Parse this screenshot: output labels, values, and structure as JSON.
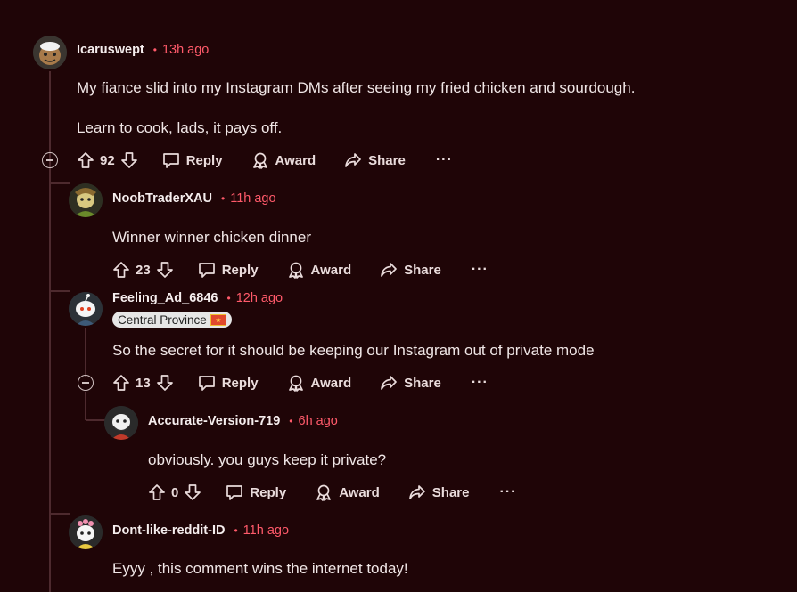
{
  "comments": [
    {
      "username": "Icaruswept",
      "time": "13h ago",
      "lines": [
        "My fiance slid into my Instagram DMs after seeing my fried chicken and sourdough.",
        "Learn to cook, lads, it pays off."
      ],
      "votes": "92",
      "avatar_icon": "avatar-icon"
    },
    {
      "username": "NoobTraderXAU",
      "time": "11h ago",
      "lines": [
        "Winner winner chicken dinner"
      ],
      "votes": "23",
      "avatar_icon": "avatar-icon"
    },
    {
      "username": "Feeling_Ad_6846",
      "time": "12h ago",
      "flair": "Central Province",
      "lines": [
        "So the secret for it should be keeping our Instagram out of private mode"
      ],
      "votes": "13",
      "avatar_icon": "avatar-icon"
    },
    {
      "username": "Accurate-Version-719",
      "time": "6h ago",
      "lines": [
        "obviously. you guys keep it private?"
      ],
      "votes": "0",
      "avatar_icon": "avatar-icon"
    },
    {
      "username": "Dont-like-reddit-ID",
      "time": "11h ago",
      "lines": [
        "Eyyy , this comment wins the internet today!"
      ],
      "avatar_icon": "avatar-icon"
    }
  ],
  "actions": {
    "reply": "Reply",
    "award": "Award",
    "share": "Share",
    "more": "···"
  },
  "colors": {
    "background": "#1f0507",
    "timestamp": "#ff5a6a",
    "thread_line": "#4d2a2e"
  }
}
